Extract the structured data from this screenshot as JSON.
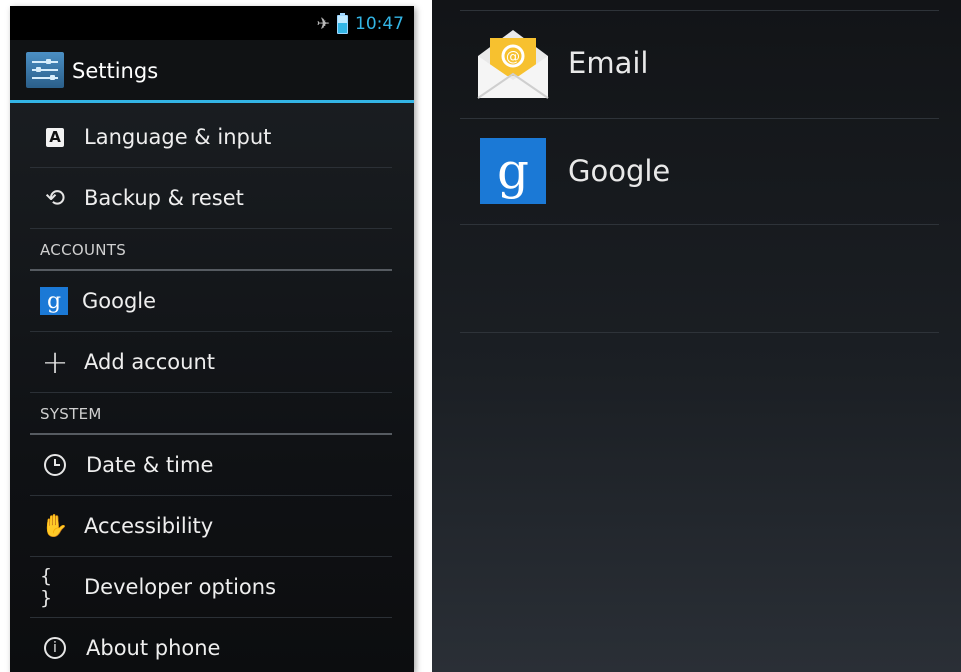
{
  "status_bar": {
    "time": "10:47",
    "icons": [
      "airplane-icon",
      "battery-icon"
    ]
  },
  "action_bar": {
    "title": "Settings",
    "icon": "settings-app-icon"
  },
  "settings_list": {
    "items_top": [
      {
        "label": "Language & input",
        "icon": "language-icon",
        "glyph": "A"
      },
      {
        "label": "Backup & reset",
        "icon": "backup-reset-icon",
        "glyph": "⟲"
      }
    ],
    "accounts_header": "ACCOUNTS",
    "accounts_items": [
      {
        "label": "Google",
        "icon": "google-icon",
        "glyph": "g"
      },
      {
        "label": "Add account",
        "icon": "plus-icon",
        "glyph": "+"
      }
    ],
    "system_header": "SYSTEM",
    "system_items": [
      {
        "label": "Date & time",
        "icon": "clock-icon"
      },
      {
        "label": "Accessibility",
        "icon": "hand-icon",
        "glyph": "✋"
      },
      {
        "label": "Developer options",
        "icon": "braces-icon",
        "glyph": "{ }"
      },
      {
        "label": "About phone",
        "icon": "info-icon",
        "glyph": "i"
      }
    ]
  },
  "account_picker": {
    "items": [
      {
        "label": "Email",
        "icon": "email-icon"
      },
      {
        "label": "Google",
        "icon": "google-icon",
        "glyph": "g"
      }
    ]
  },
  "colors": {
    "accent": "#33b5e5",
    "google_blue": "#1b79d6",
    "email_yellow": "#f7c12f"
  }
}
